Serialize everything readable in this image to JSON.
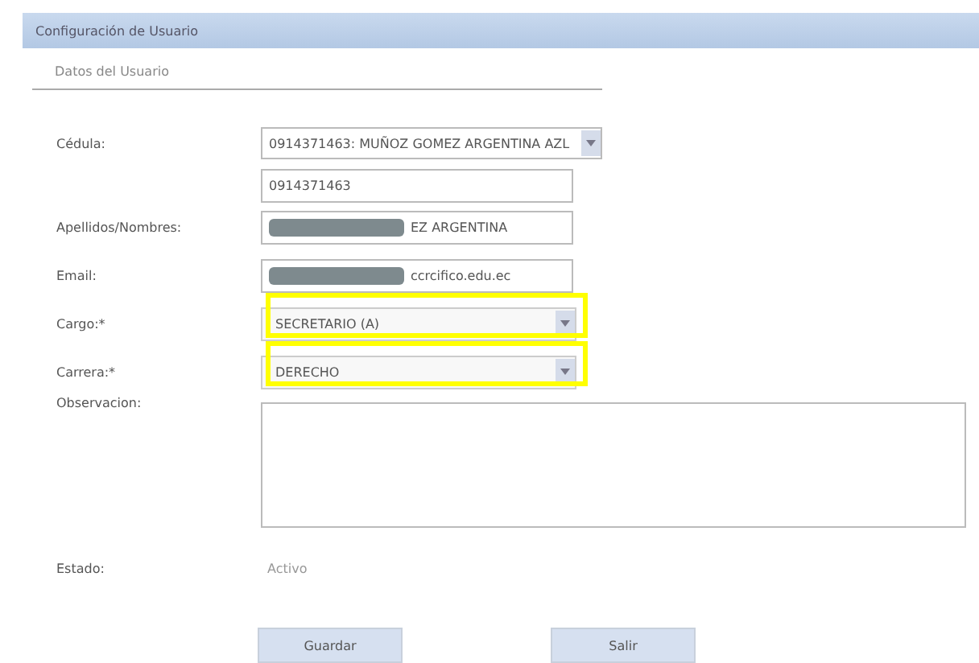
{
  "window": {
    "title": "Configuración de Usuario"
  },
  "section": {
    "title": "Datos del Usuario"
  },
  "fields": [
    {
      "label": "Cédula:",
      "kind": "combo",
      "value": "0914371463: MUÑOZ GOMEZ ARGENTINA AZL"
    },
    {
      "kind": "text",
      "value": "0914371463"
    },
    {
      "label": "Apellidos/Nombres:",
      "kind": "text",
      "value": "EZ ARGENTINA",
      "redacted": true
    },
    {
      "label": "Email:",
      "kind": "text",
      "value": "ccrcifico.edu.ec",
      "redacted": true
    },
    {
      "label": "Cargo:*",
      "kind": "select",
      "value": "SECRETARIO (A)",
      "highlighted": true
    },
    {
      "label": "Carrera:*",
      "kind": "select",
      "value": "DERECHO",
      "highlighted": true
    },
    {
      "label": "Observacion:",
      "kind": "textarea"
    },
    {
      "label": "Estado:",
      "kind": "static",
      "value": "Activo"
    }
  ],
  "buttons": [
    "Guardar",
    "Salir"
  ]
}
